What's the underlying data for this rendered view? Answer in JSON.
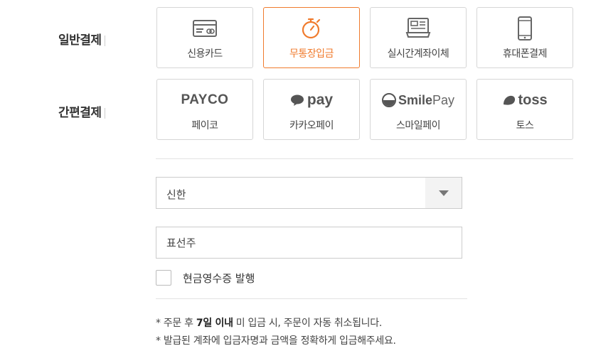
{
  "sections": {
    "general": "일반결제",
    "simple": "간편결제"
  },
  "general_methods": [
    {
      "label": "신용카드",
      "icon": "credit-card-icon"
    },
    {
      "label": "무통장입금",
      "icon": "stopwatch-icon"
    },
    {
      "label": "실시간계좌이체",
      "icon": "bank-terminal-icon"
    },
    {
      "label": "휴대폰결제",
      "icon": "mobile-phone-icon"
    }
  ],
  "simple_methods": [
    {
      "label": "페이코",
      "brand": "PAYCO"
    },
    {
      "label": "카카오페이",
      "brand": "pay"
    },
    {
      "label": "스마일페이",
      "brand_a": "Smile",
      "brand_b": "Pay"
    },
    {
      "label": "토스",
      "brand": "toss"
    }
  ],
  "selected_method": "무통장입금",
  "bank_select": {
    "value": "신한"
  },
  "depositor": {
    "value": "표선주"
  },
  "cash_receipt": {
    "label": "현금영수증 발행",
    "checked": false
  },
  "notes": {
    "line1_prefix": "* 주문 후 ",
    "line1_bold": "7일 이내",
    "line1_suffix": " 미 입금 시, 주문이 자동 취소됩니다.",
    "line2": "* 발급된 계좌에 입금자명과 금액을 정확하게 입금해주세요."
  },
  "colors": {
    "accent": "#f07b2d",
    "border": "#d6d6d6"
  }
}
